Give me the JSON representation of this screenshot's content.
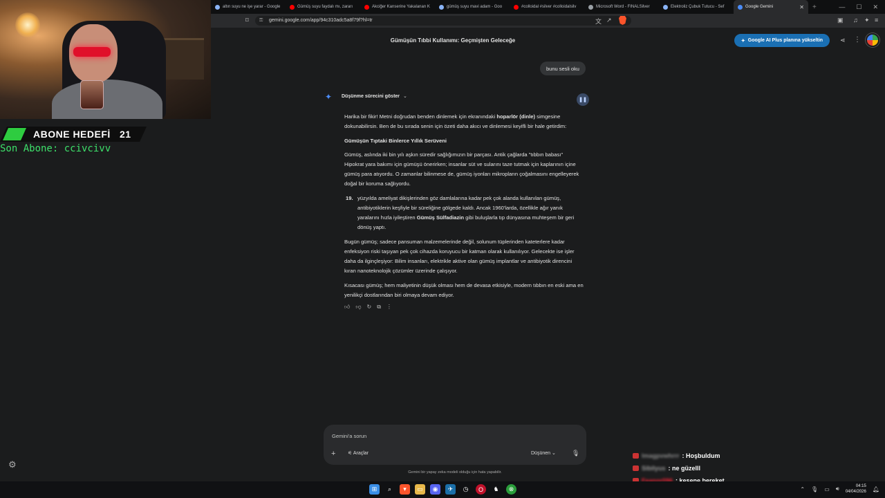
{
  "overlay": {
    "goal_label": "ABONE HEDEFİ",
    "goal_count": "21",
    "last_sub": "Son Abone: ccivcivv",
    "chat": [
      {
        "user": "lmagpvwhrrr",
        "msg": ": Hoşbuldum"
      },
      {
        "user": "Sibilyus",
        "msg": ": ne güzelll"
      },
      {
        "user": "Feanor096",
        "msg": ": kesene bereket"
      },
      {
        "user": "",
        "msg": ""
      }
    ]
  },
  "browser": {
    "tabs": [
      {
        "label": "altın suyu ne işe yarar - Google",
        "color": "#8ab4f8"
      },
      {
        "label": "Gümüş suyu faydalı mı, zararı",
        "color": "#ff0000"
      },
      {
        "label": "Akciğer Kanserine Yakalanan K",
        "color": "#ff0000"
      },
      {
        "label": "gümüş suyu mavi adam - Goo",
        "color": "#8ab4f8"
      },
      {
        "label": "#colloidal #silver #colloidalsilv",
        "color": "#ff0000"
      },
      {
        "label": "Microsoft Word - FINALSilver",
        "color": "#9aa0a6"
      },
      {
        "label": "Elektroliz Çubuk Tutucu - Sef",
        "color": "#8ab4f8"
      },
      {
        "label": "Google Gemini",
        "color": "#4b8cf7"
      }
    ],
    "url": "gemini.google.com/app/94c310adc5a8f79f?hl=tr"
  },
  "gemini": {
    "title": "Gümüşün Tıbbi Kullanımı: Geçmişten Geleceğe",
    "upgrade_label": "Google AI Plus planına yükseltin",
    "user_message": "bunu sesli oku",
    "thinking_label": "Düşünme sürecini göster",
    "answer": {
      "p1_a": "Harika bir fikir! Metni doğrudan benden dinlemek için ekranındaki ",
      "p1_b": "hoparlör (dinle)",
      "p1_c": " simgesine dokunabilirsin. Ben de bu sırada senin için özeti daha akıcı ve dinlemesi keyifli bir hale getirdim:",
      "heading": "Gümüşün Tıptaki Binlerce Yıllık Serüveni",
      "p2": "Gümüş, aslında iki bin yılı aşkın süredir sağlığımızın bir parçası. Antik çağlarda \"tıbbın babası\" Hipokrat yara bakımı için gümüşü önerirken; insanlar süt ve sularını taze tutmak için kaplarının içine gümüş para atıyordu. O zamanlar bilinmese de, gümüş iyonları mikropların çoğalmasını engelleyerek doğal bir koruma sağlıyordu.",
      "li_num": "19.",
      "li_a": "yüzyılda ameliyat dikişlerinden göz damlalarına kadar pek çok alanda kullanılan gümüş, antibiyotiklerin keşfiyle bir süreliğine gölgede kaldı. Ancak 1960'larda, özellikle ağır yanık yaralarını hızla iyileştiren ",
      "li_b": "Gümüş Sülfadiazin",
      "li_c": " gibi buluşlarla tıp dünyasına muhteşem bir geri dönüş yaptı.",
      "p3": "Bugün gümüş; sadece pansuman malzemelerinde değil, solunum tüplerinden kateterlere kadar enfeksiyon riski taşıyan pek çok cihazda koruyucu bir katman olarak kullanılıyor. Gelecekte ise işler daha da ilginçleşiyor: Bilim insanları, elektrikle aktive olan gümüş implantlar ve antibiyotik direncini kıran nanoteknolojik çözümler üzerinde çalışıyor.",
      "p4": "Kısacası gümüş; hem maliyetinin düşük olması hem de devasa etkisiyle, modern tıbbın en eski ama en yenilikçi dostlarından biri olmaya devam ediyor."
    },
    "composer": {
      "placeholder": "Gemini'a sorun",
      "tools_label": "Araçlar",
      "mode_label": "Düşünen"
    },
    "disclaimer": "Gemini bir yapay zeka modeli olduğu için hata yapabilir."
  },
  "taskbar": {
    "time": "04:15",
    "date": "04/04/2026"
  },
  "colors": {
    "accent": "#1a6fb3",
    "gemini_star": "#4b8cf7",
    "goal_green": "#2ecc40"
  }
}
